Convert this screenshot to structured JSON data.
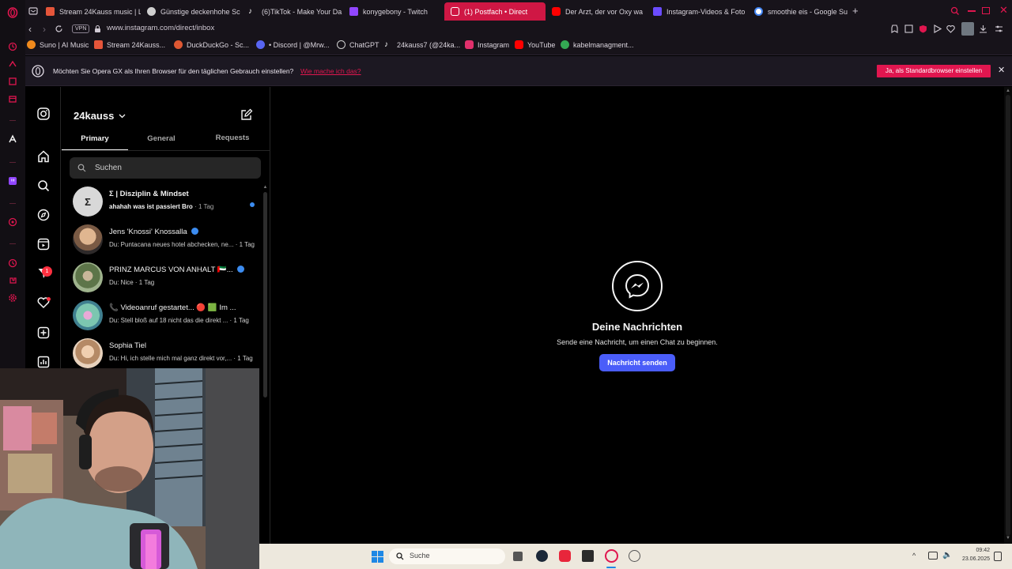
{
  "browser": {
    "tabs": [
      {
        "label": "Stream 24Kauss music | L",
        "color": "#e5553a"
      },
      {
        "label": "Günstige deckenhohe Sc",
        "color": "#cfcfcf"
      },
      {
        "label": "(6)TikTok - Make Your Da",
        "color": "#ffffff"
      },
      {
        "label": "konygebony - Twitch",
        "color": "#9146ff"
      },
      {
        "label": "(1) Postfach • Direct",
        "color": "#e1306c"
      },
      {
        "label": "Der Arzt, der vor Oxy wa",
        "color": "#ff0000"
      },
      {
        "label": "Instagram-Videos & Foto",
        "color": "#6b4cff"
      },
      {
        "label": "smoothie eis - Google Su",
        "color": "#4285f4"
      }
    ],
    "vpn_label": "VPN",
    "url": "www.instagram.com/direct/inbox",
    "bookmarks": [
      {
        "label": "Suno | AI Music",
        "color": "#f08a1c"
      },
      {
        "label": "Stream 24Kauss...",
        "color": "#e5553a"
      },
      {
        "label": "DuckDuckGo - Sc...",
        "color": "#de5833"
      },
      {
        "label": "• Discord | @Mrw...",
        "color": "#5865f2"
      },
      {
        "label": "ChatGPT",
        "color": "#cfcfcf"
      },
      {
        "label": "24kauss7 (@24ka...",
        "color": "#ffffff"
      },
      {
        "label": "Instagram",
        "color": "#e1306c"
      },
      {
        "label": "YouTube",
        "color": "#ff0000"
      },
      {
        "label": "kabelmanagment...",
        "color": "#34a853"
      }
    ],
    "banner": {
      "text": "Möchten Sie Opera GX als Ihren Browser für den täglichen Gebrauch einstellen?",
      "link": "Wie mache ich das?",
      "button": "Ja, als Standardbrowser einstellen",
      "accent": "#e0164f"
    }
  },
  "instagram": {
    "username": "24kauss",
    "tabs": [
      "Primary",
      "General",
      "Requests"
    ],
    "search_placeholder": "Suchen",
    "notification_count": "1",
    "chats": [
      {
        "name": "Σ | Disziplin & Mindset",
        "preview": "ahahah was ist passiert Bro",
        "time": "· 1 Tag",
        "unread": true,
        "avatar_color": "#d8d8d8"
      },
      {
        "name": "Jens 'Knossi' Knossalla",
        "preview": "Du: Puntacana neues hotel abchecken, ne...",
        "time": "· 1 Tag",
        "verified": true,
        "avatar_color": "#c9a27a"
      },
      {
        "name": "PRINZ MARCUS VON ANHALT 🇦🇪...",
        "preview": "Du: Nice",
        "time": "· 1 Tag",
        "verified": true,
        "avatar_color": "#6e8a5a"
      },
      {
        "name": "📞 Videoanruf gestartet... 🔴 🟩 Im ...",
        "preview": "Du: Stell bloß auf 18 nicht das die direkt ...",
        "time": "· 1 Tag",
        "avatar_color": "#6fb5a3"
      },
      {
        "name": "Sophia Tiel",
        "preview": "Du: Hi, ich stelle mich mal ganz direkt vor,...",
        "time": "· 1 Tag",
        "avatar_color": "#d9b394"
      }
    ],
    "empty_state": {
      "title": "Deine Nachrichten",
      "subtitle": "Sende eine Nachricht, um einen Chat zu beginnen.",
      "button": "Nachricht senden",
      "button_color": "#4a5df9"
    }
  },
  "taskbar": {
    "search_placeholder": "Suche",
    "time": "09:42",
    "date": "23.06.2025"
  }
}
